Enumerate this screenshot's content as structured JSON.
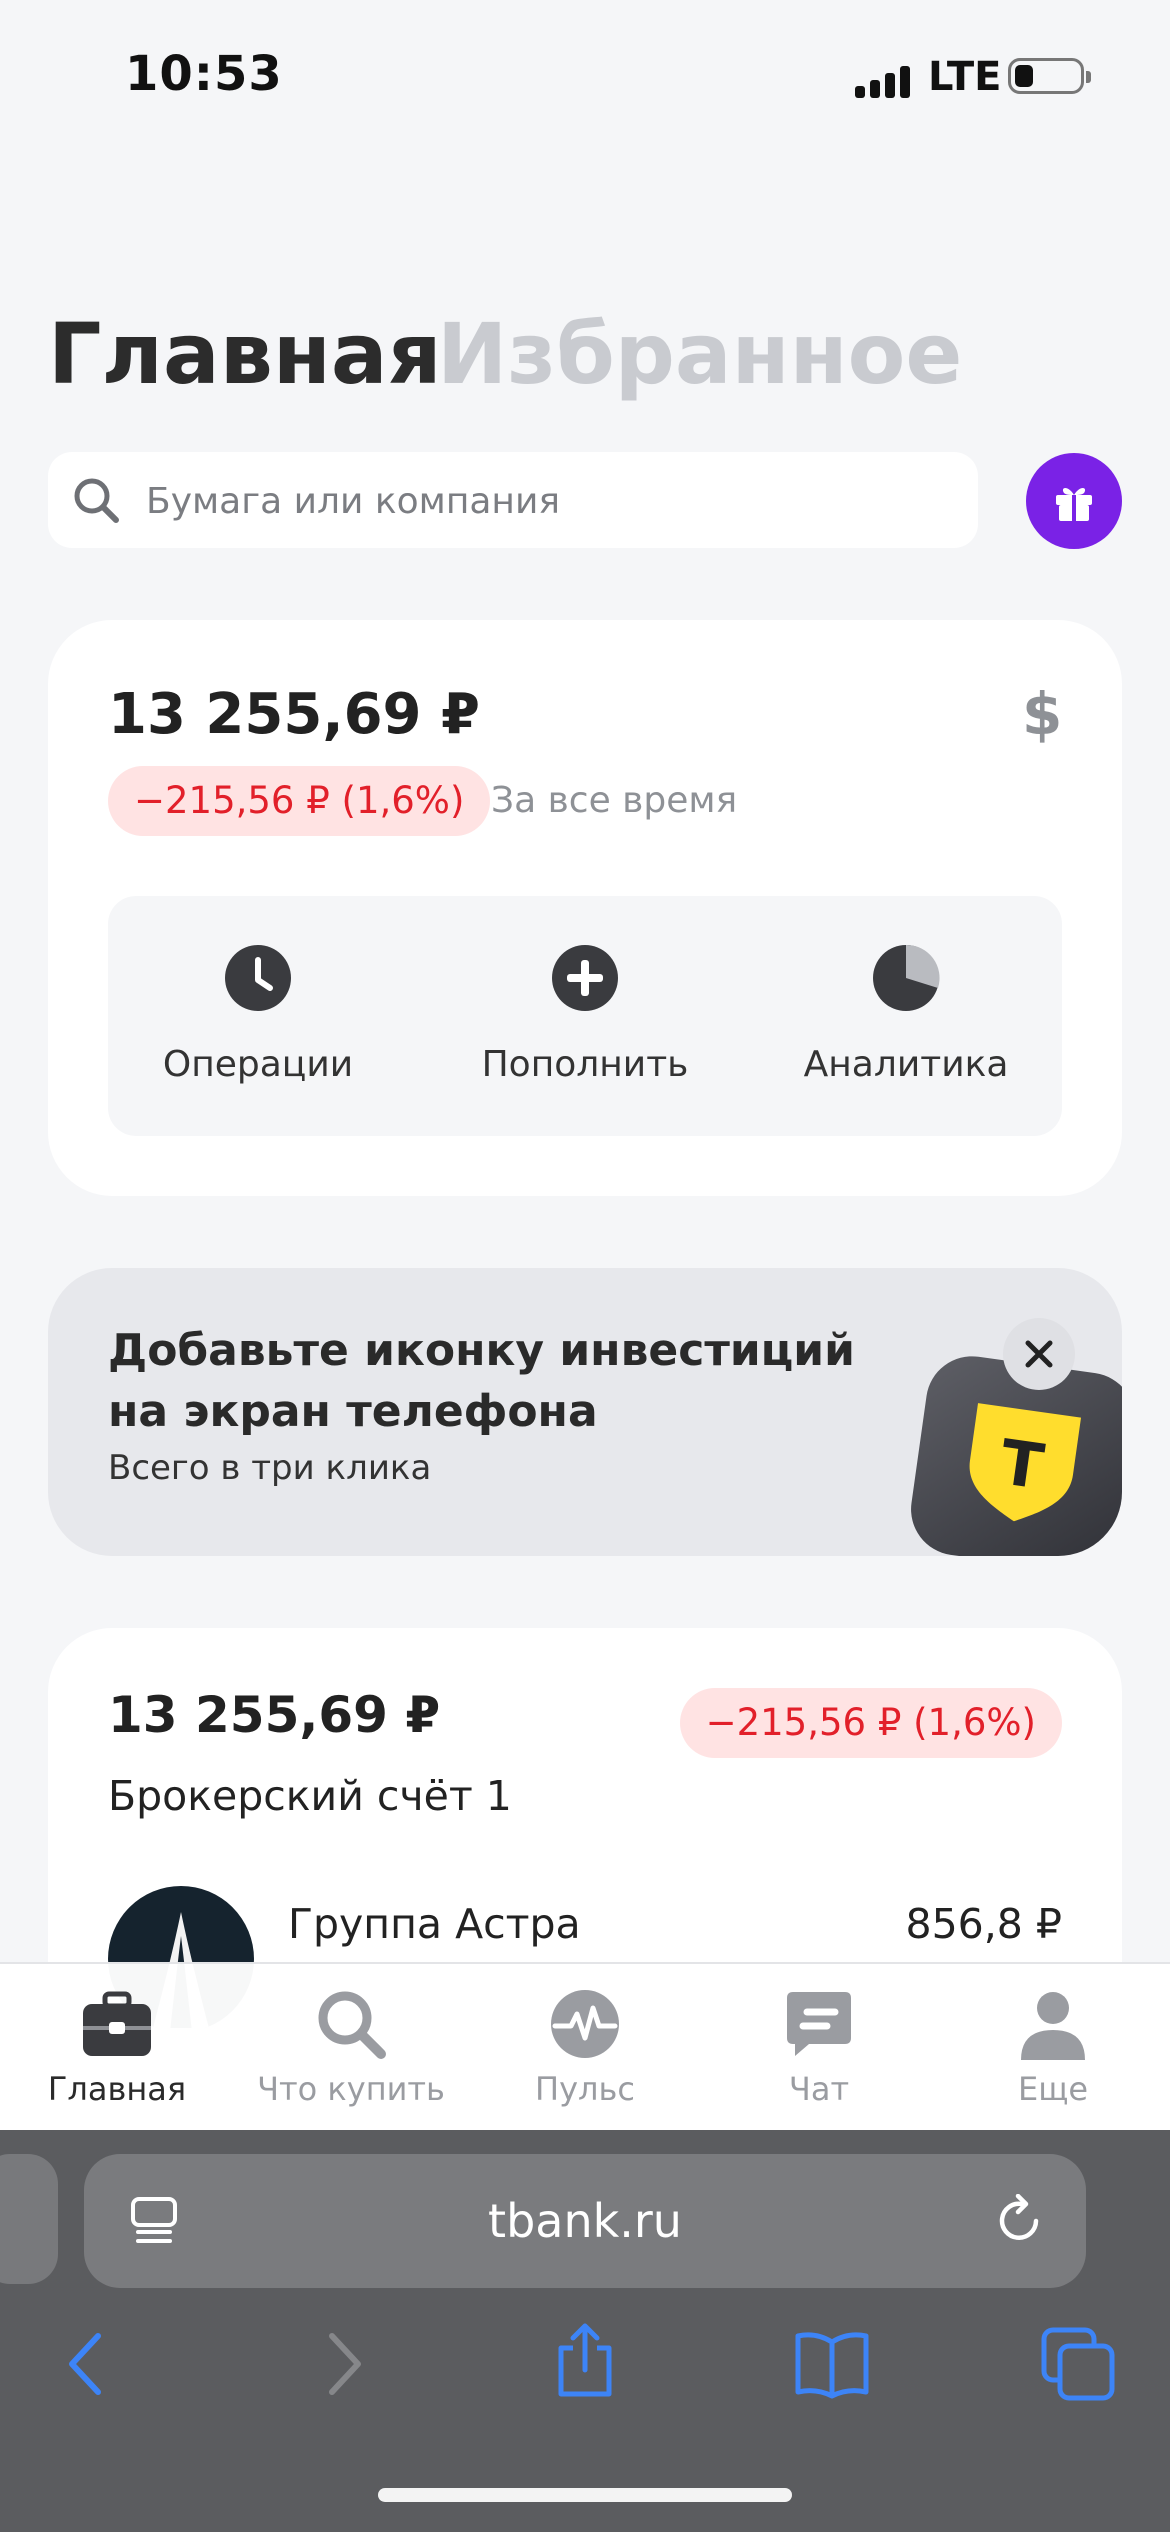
{
  "status_bar": {
    "time": "10:53",
    "network": "LTE"
  },
  "header": {
    "tabs": [
      {
        "label": "Главная",
        "active": true
      },
      {
        "label": "Избранное",
        "active": false
      }
    ]
  },
  "search": {
    "placeholder": "Бумага или компания",
    "value": ""
  },
  "portfolio": {
    "total": "13 255,69 ₽",
    "currency_symbol": "$",
    "change": "−215,56 ₽ (1,6%)",
    "period": "За все время",
    "actions": [
      {
        "label": "Операции",
        "icon": "clock-icon"
      },
      {
        "label": "Пополнить",
        "icon": "plus-circle-icon"
      },
      {
        "label": "Аналитика",
        "icon": "pie-chart-icon"
      }
    ]
  },
  "promo": {
    "title": "Добавьте иконку инвестиций на экран телефона",
    "subtitle": "Всего в три клика",
    "app_icon_letter": "T"
  },
  "account": {
    "value": "13 255,69 ₽",
    "change": "−215,56 ₽ (1,6%)",
    "name": "Брокерский счёт 1",
    "holdings": [
      {
        "name": "Группа Астра",
        "price": "856,8 ₽"
      }
    ]
  },
  "tabbar": {
    "items": [
      {
        "label": "Главная",
        "icon": "briefcase-icon",
        "active": true
      },
      {
        "label": "Что купить",
        "icon": "search-icon",
        "active": false
      },
      {
        "label": "Пульс",
        "icon": "pulse-icon",
        "active": false
      },
      {
        "label": "Чат",
        "icon": "chat-icon",
        "active": false
      },
      {
        "label": "Еще",
        "icon": "profile-icon",
        "active": false
      }
    ]
  },
  "browser": {
    "url": "tbank.ru"
  },
  "colors": {
    "accent_purple": "#7a22e6",
    "negative_red": "#e2202a",
    "negative_bg": "#ffe3e3",
    "brand_yellow": "#ffdd2d"
  }
}
